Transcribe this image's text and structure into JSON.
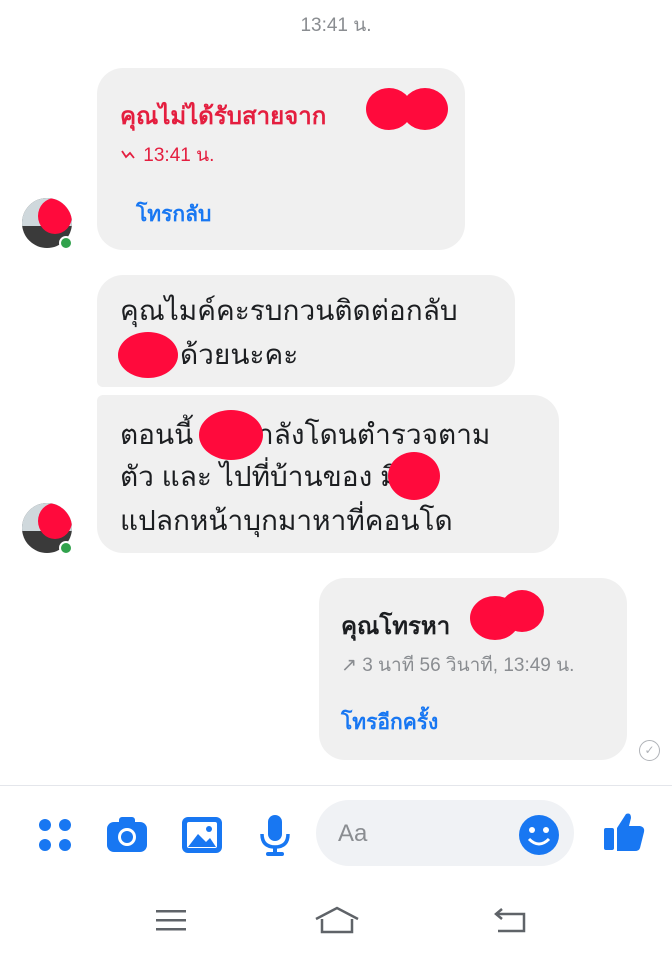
{
  "top_time": "13:41 น.",
  "missed_call": {
    "title": "คุณไม่ได้รับสายจาก",
    "time": "13:41 น.",
    "call_back": "โทรกลับ"
  },
  "messages": [
    {
      "lines": [
        "คุณไมค์คะรบกวนติดต่อกลับ",
        "ด้วยนะคะ"
      ]
    },
    {
      "lines": [
        "ตอนนี้ กำลังโดนตำรวจตาม",
        "ตัว และ ไปที่บ้านของ มีคน",
        "แปลกหน้าบุกมาหาที่คอนโด"
      ]
    }
  ],
  "outgoing_call": {
    "title": "คุณโทรหา",
    "duration": "3 นาที 56 วินาที, 13:49 น.",
    "call_again": "โทรอีกครั้ง"
  },
  "composer": {
    "placeholder": "Aa"
  },
  "colors": {
    "accent": "#1877f2",
    "missed": "#e41e3f",
    "bubble": "#f0f0f0",
    "redaction": "#ff0a3c"
  }
}
